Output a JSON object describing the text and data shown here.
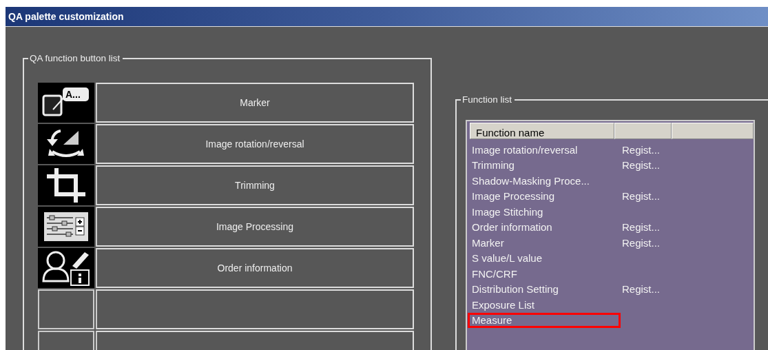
{
  "window": {
    "title": "QA palette customization"
  },
  "button_list": {
    "legend": "QA function button list",
    "buttons": [
      {
        "kind": "filled",
        "icon_text": "A...",
        "label": "Marker"
      },
      {
        "kind": "filled",
        "label": "Image rotation/reversal"
      },
      {
        "kind": "filled",
        "label": "Trimming"
      },
      {
        "kind": "filled",
        "label": "Image Processing"
      },
      {
        "kind": "filled",
        "label": "Order information"
      },
      {
        "kind": "empty"
      },
      {
        "kind": "empty"
      }
    ]
  },
  "function_list": {
    "legend": "Function list",
    "columns": [
      "Function name"
    ],
    "rows": [
      {
        "name": "Image rotation/reversal",
        "status": "Regist...",
        "highlighted": false
      },
      {
        "name": "Trimming",
        "status": "Regist...",
        "highlighted": false
      },
      {
        "name": "Shadow-Masking Proce...",
        "highlighted": false
      },
      {
        "name": "Image Processing",
        "status": "Regist...",
        "highlighted": false
      },
      {
        "name": "Image Stitching",
        "highlighted": false
      },
      {
        "name": "Order information",
        "status": "Regist...",
        "highlighted": false
      },
      {
        "name": "Marker",
        "status": "Regist...",
        "highlighted": false
      },
      {
        "name": "S value/L value",
        "highlighted": false
      },
      {
        "name": "FNC/CRF",
        "highlighted": false
      },
      {
        "name": "Distribution Setting",
        "status": "Regist...",
        "highlighted": false
      },
      {
        "name": "Exposure List",
        "highlighted": false
      },
      {
        "name": "Measure",
        "highlighted": true
      }
    ]
  }
}
